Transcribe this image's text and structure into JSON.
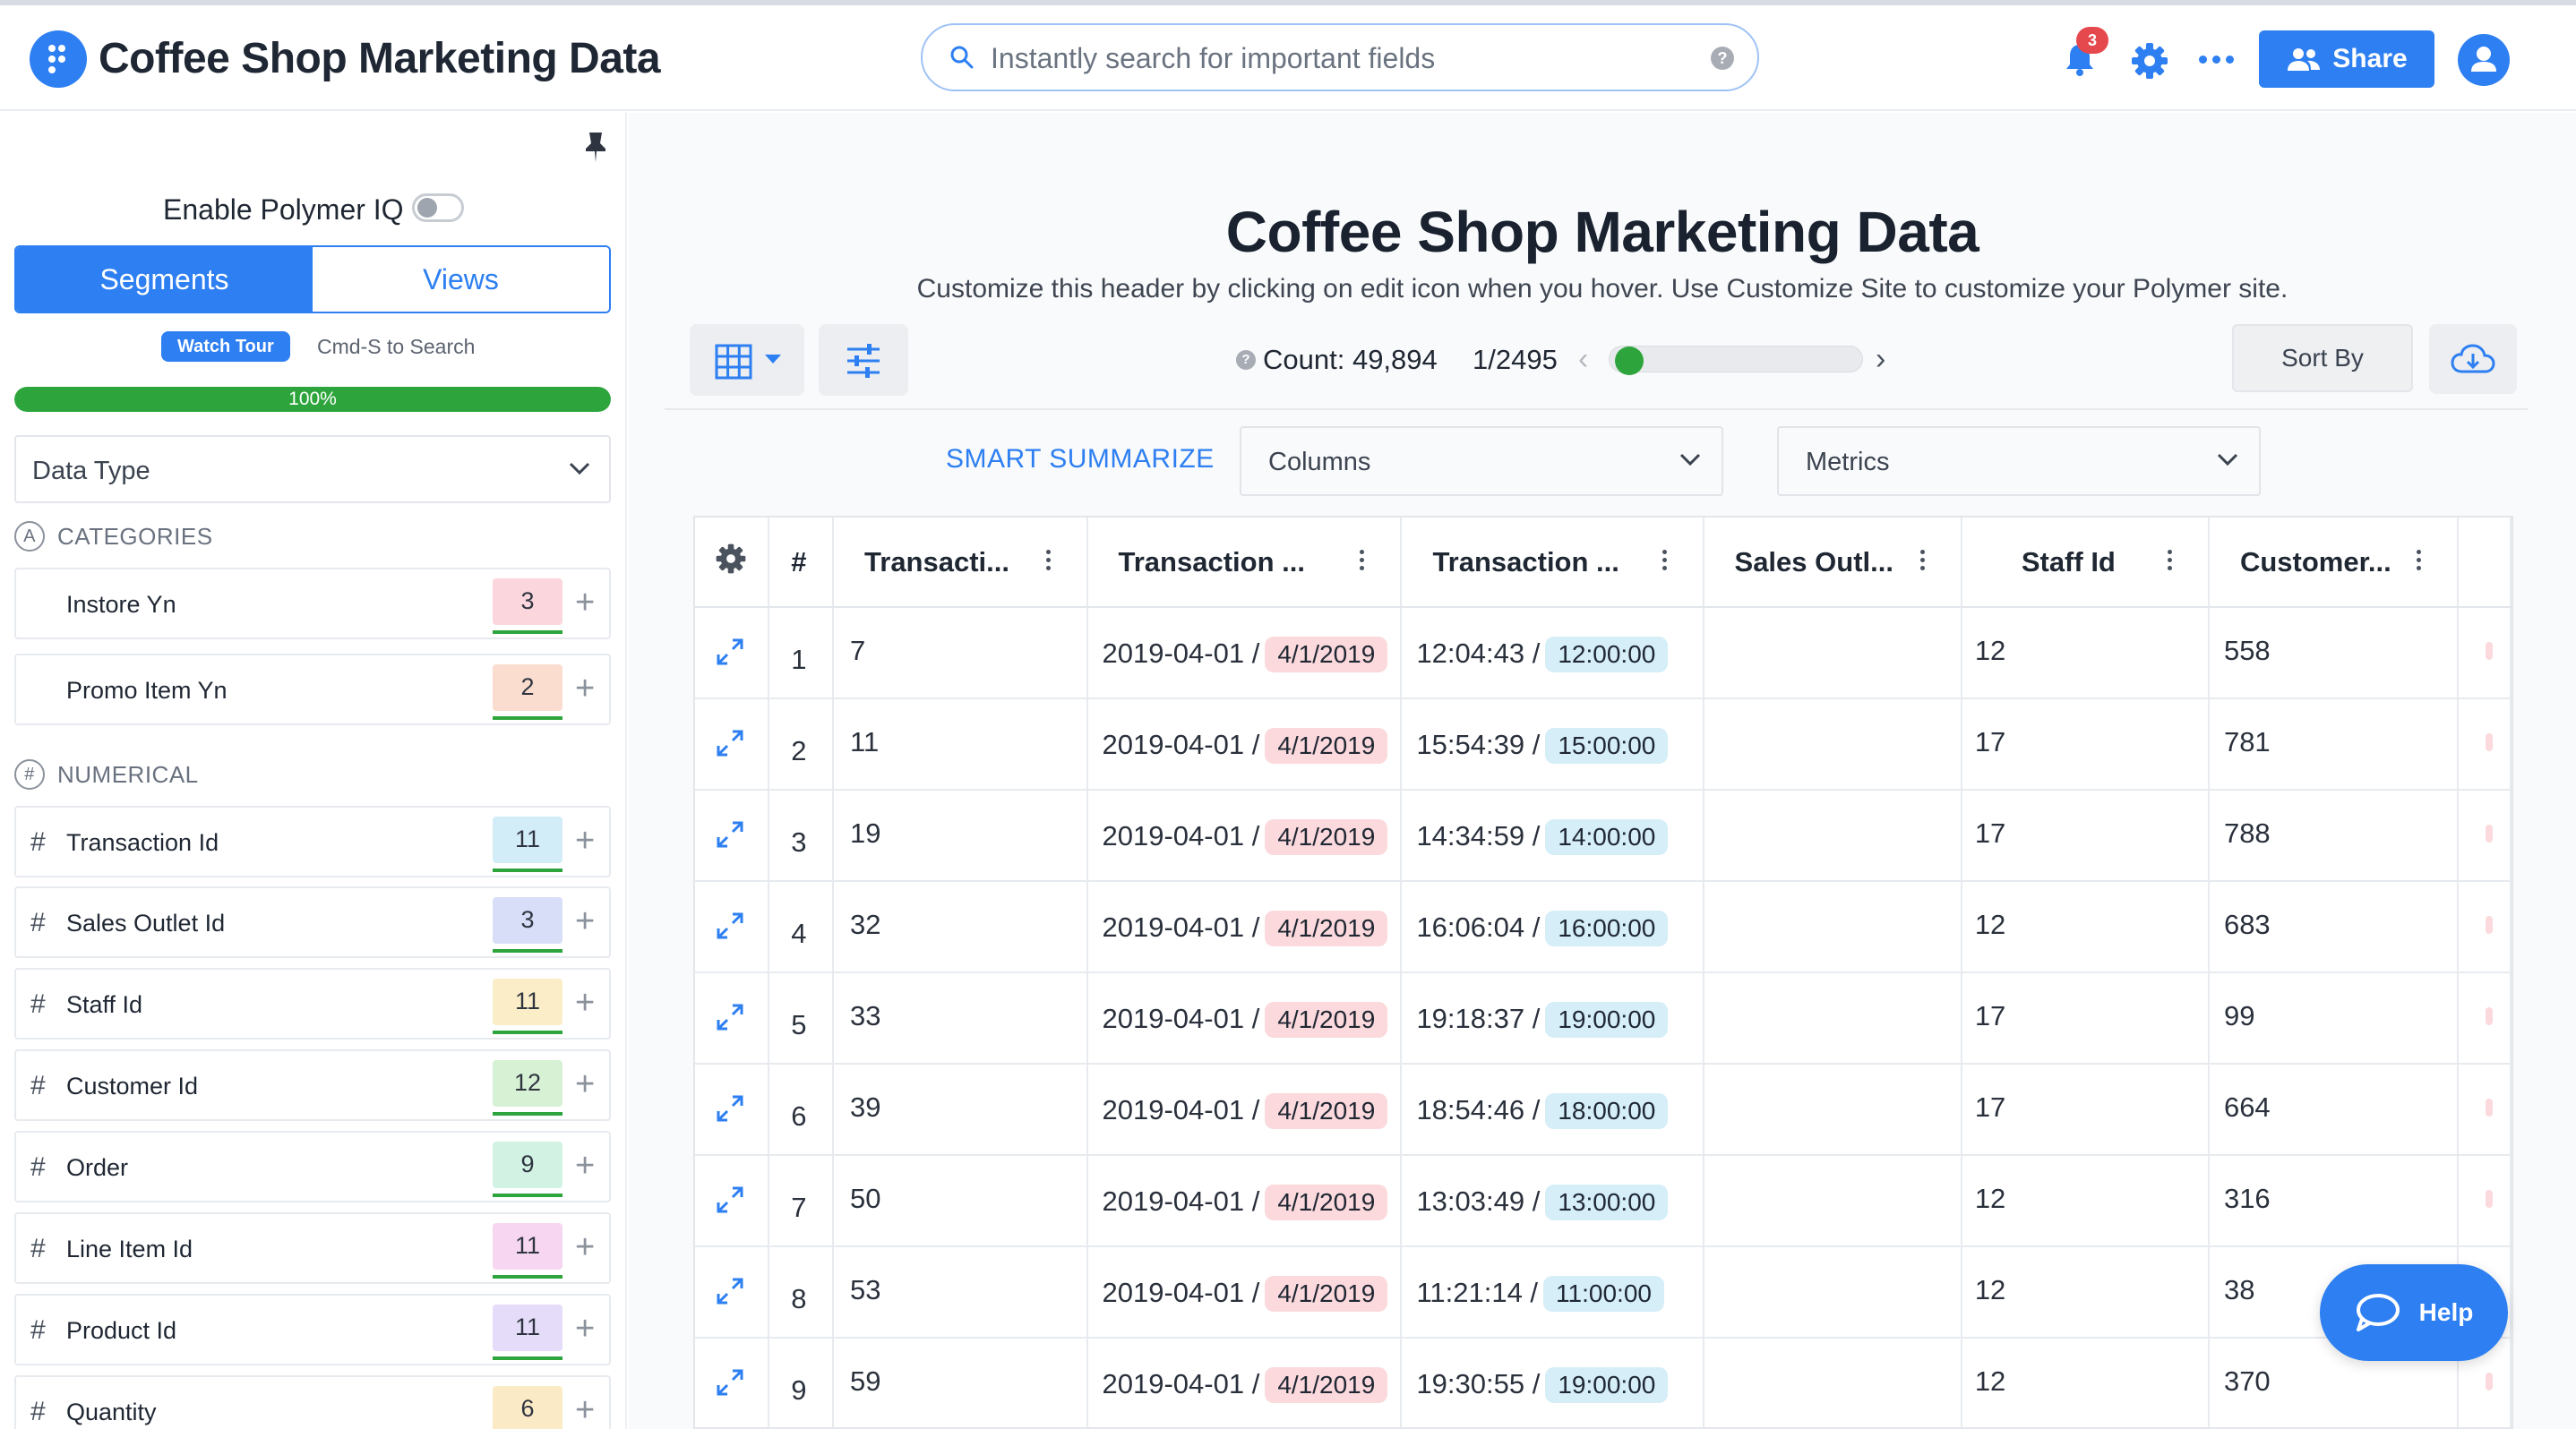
{
  "header": {
    "app_title": "Coffee Shop Marketing Data",
    "search_placeholder": "Instantly search for important fields",
    "notifications_count": "3",
    "share_label": "Share"
  },
  "sidebar": {
    "iq_label": "Enable Polymer IQ",
    "tabs": [
      "Segments",
      "Views"
    ],
    "active_tab": "Segments",
    "watch_tour": "Watch Tour",
    "cmd_search": "Cmd-S to Search",
    "progress_value": 1.0,
    "progress_text": "100%",
    "data_type": "Data Type",
    "categories_title": "CATEGORIES",
    "numerical_title": "NUMERICAL",
    "categories": [
      {
        "label": "Instore Yn",
        "count": "3",
        "color": "#fbd6dc"
      },
      {
        "label": "Promo Item Yn",
        "count": "2",
        "color": "#fbddd0"
      }
    ],
    "numerical": [
      {
        "label": "Transaction Id",
        "count": "11",
        "color": "#d2ecf8"
      },
      {
        "label": "Sales Outlet Id",
        "count": "3",
        "color": "#d8def8"
      },
      {
        "label": "Staff Id",
        "count": "11",
        "color": "#fbedc8"
      },
      {
        "label": "Customer Id",
        "count": "12",
        "color": "#d6f1d4"
      },
      {
        "label": "Order",
        "count": "9",
        "color": "#d2f2e4"
      },
      {
        "label": "Line Item Id",
        "count": "11",
        "color": "#f6d6f0"
      },
      {
        "label": "Product Id",
        "count": "11",
        "color": "#e4dcf8"
      },
      {
        "label": "Quantity",
        "count": "6",
        "color": "#fbeac6"
      }
    ]
  },
  "main": {
    "title": "Coffee Shop Marketing Data",
    "subtitle": "Customize this header by clicking on edit icon when you hover. Use Customize Site to customize your Polymer site.",
    "count_label": "Count: 49,894",
    "page_label": "1/2495",
    "sort_by": "Sort By",
    "smart_summarize": "SMART SUMMARIZE",
    "columns_dropdown": "Columns",
    "metrics_dropdown": "Metrics",
    "help_label": "Help"
  },
  "table": {
    "columns": [
      "#",
      "Transacti...",
      "Transaction ...",
      "Transaction ...",
      "Sales Outl...",
      "Staff Id",
      "Customer..."
    ],
    "rows": [
      {
        "n": "1",
        "id": "7",
        "date": "2019-04-01 /",
        "date_pill": "4/1/2019",
        "time": "12:04:43 /",
        "time_pill": "12:00:00",
        "outlet": "",
        "staff": "12",
        "customer": "558"
      },
      {
        "n": "2",
        "id": "11",
        "date": "2019-04-01 /",
        "date_pill": "4/1/2019",
        "time": "15:54:39 /",
        "time_pill": "15:00:00",
        "outlet": "",
        "staff": "17",
        "customer": "781"
      },
      {
        "n": "3",
        "id": "19",
        "date": "2019-04-01 /",
        "date_pill": "4/1/2019",
        "time": "14:34:59 /",
        "time_pill": "14:00:00",
        "outlet": "",
        "staff": "17",
        "customer": "788"
      },
      {
        "n": "4",
        "id": "32",
        "date": "2019-04-01 /",
        "date_pill": "4/1/2019",
        "time": "16:06:04 /",
        "time_pill": "16:00:00",
        "outlet": "",
        "staff": "12",
        "customer": "683"
      },
      {
        "n": "5",
        "id": "33",
        "date": "2019-04-01 /",
        "date_pill": "4/1/2019",
        "time": "19:18:37 /",
        "time_pill": "19:00:00",
        "outlet": "",
        "staff": "17",
        "customer": "99"
      },
      {
        "n": "6",
        "id": "39",
        "date": "2019-04-01 /",
        "date_pill": "4/1/2019",
        "time": "18:54:46 /",
        "time_pill": "18:00:00",
        "outlet": "",
        "staff": "17",
        "customer": "664"
      },
      {
        "n": "7",
        "id": "50",
        "date": "2019-04-01 /",
        "date_pill": "4/1/2019",
        "time": "13:03:49 /",
        "time_pill": "13:00:00",
        "outlet": "",
        "staff": "12",
        "customer": "316"
      },
      {
        "n": "8",
        "id": "53",
        "date": "2019-04-01 /",
        "date_pill": "4/1/2019",
        "time": "11:21:14 /",
        "time_pill": "11:00:00",
        "outlet": "",
        "staff": "12",
        "customer": "38"
      },
      {
        "n": "9",
        "id": "59",
        "date": "2019-04-01 /",
        "date_pill": "4/1/2019",
        "time": "19:30:55 /",
        "time_pill": "19:00:00",
        "outlet": "",
        "staff": "12",
        "customer": "370"
      }
    ]
  },
  "colors": {
    "accent": "#2d7ff2",
    "success": "#2da53c",
    "badge": "#e5484d"
  },
  "icons": [
    "logo-icon",
    "search-icon",
    "help-icon",
    "bell-icon",
    "gear-icon",
    "more-icon",
    "people-icon",
    "avatar-icon",
    "pin-icon",
    "chevron-down-icon",
    "grid-icon",
    "filter-icon",
    "cloud-download-icon",
    "expand-icon",
    "chat-icon"
  ]
}
